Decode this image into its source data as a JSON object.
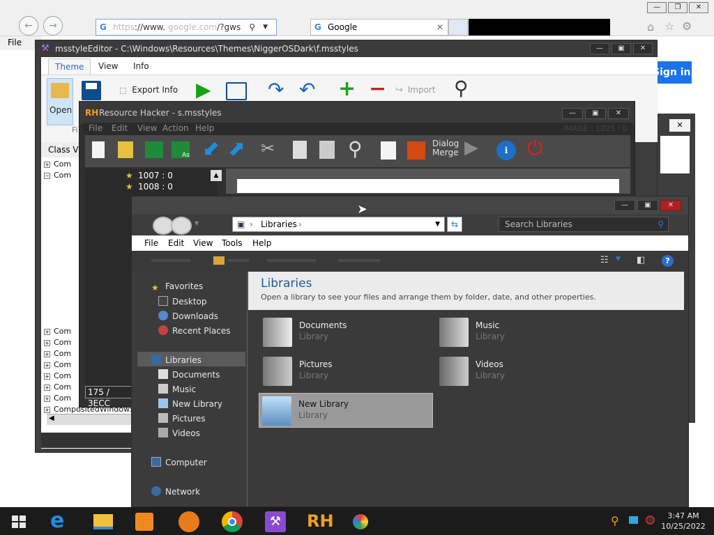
{
  "browser": {
    "address_text": "://www.",
    "address_suffix": "/?gws",
    "tab_title": "Google",
    "menu_file": "File",
    "signin_label": "Sign in"
  },
  "mse": {
    "title": "msstyleEditor - C:\\Windows\\Resources\\Themes\\NiggerOSDark\\f.msstyles",
    "tabs": [
      "Theme",
      "View",
      "Info"
    ],
    "buttons": {
      "open": "Open",
      "export": "Export Info",
      "import": "Import"
    },
    "group_label": "Fi",
    "class_view_label": "Class Vie",
    "tree_item_prefix": "Com",
    "composited_label": "CompositedWindow:"
  },
  "rh": {
    "title": "Resource Hacker - s.msstyles",
    "menu": [
      "File",
      "Edit",
      "View",
      "Action",
      "Help"
    ],
    "image_label": "IMAGE : 1025 : 0",
    "dialog_label": "Dialog Merge",
    "tree_items": [
      "1007 : 0",
      "1008 : 0"
    ],
    "status": "175 / 3ECC"
  },
  "explorer": {
    "address": "Libraries",
    "search_placeholder": "Search Libraries",
    "menu": [
      "File",
      "Edit",
      "View",
      "Tools",
      "Help"
    ],
    "nav": {
      "favorites": "Favorites",
      "desktop": "Desktop",
      "downloads": "Downloads",
      "recent": "Recent Places",
      "libraries": "Libraries",
      "documents": "Documents",
      "music": "Music",
      "new_library": "New Library",
      "pictures": "Pictures",
      "videos": "Videos",
      "computer": "Computer",
      "network": "Network"
    },
    "content": {
      "heading": "Libraries",
      "description": "Open a library to see your files and arrange them by folder, date, and other properties.",
      "items": [
        {
          "name": "Documents",
          "type": "Library"
        },
        {
          "name": "Music",
          "type": "Library"
        },
        {
          "name": "Pictures",
          "type": "Library"
        },
        {
          "name": "Videos",
          "type": "Library"
        },
        {
          "name": "New Library",
          "type": "Library"
        }
      ]
    }
  },
  "taskbar": {
    "time": "3:47 AM",
    "date": "10/25/2022",
    "rh_label": "RH"
  },
  "colors": {
    "explorer_bg": "#454545",
    "selection": "#9a9a9a",
    "heading_blue": "#1e5a96",
    "taskbar": "#1b1b1b"
  }
}
